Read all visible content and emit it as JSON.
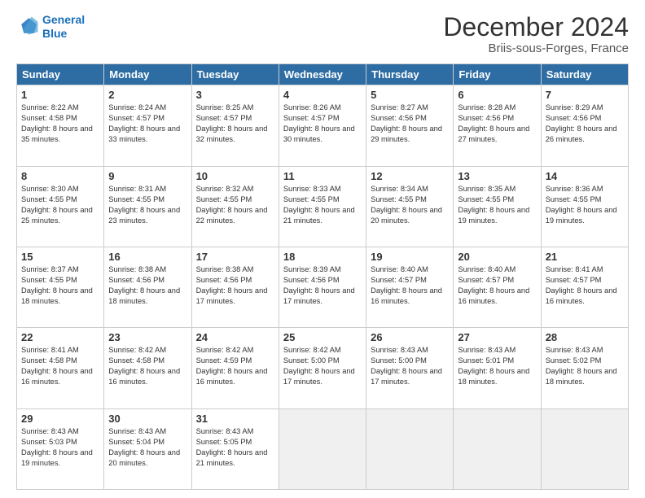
{
  "header": {
    "logo_line1": "General",
    "logo_line2": "Blue",
    "title": "December 2024",
    "subtitle": "Briis-sous-Forges, France"
  },
  "days_header": [
    "Sunday",
    "Monday",
    "Tuesday",
    "Wednesday",
    "Thursday",
    "Friday",
    "Saturday"
  ],
  "weeks": [
    [
      {
        "day": "1",
        "sunrise": "8:22 AM",
        "sunset": "4:58 PM",
        "daylight": "8 hours and 35 minutes."
      },
      {
        "day": "2",
        "sunrise": "8:24 AM",
        "sunset": "4:57 PM",
        "daylight": "8 hours and 33 minutes."
      },
      {
        "day": "3",
        "sunrise": "8:25 AM",
        "sunset": "4:57 PM",
        "daylight": "8 hours and 32 minutes."
      },
      {
        "day": "4",
        "sunrise": "8:26 AM",
        "sunset": "4:57 PM",
        "daylight": "8 hours and 30 minutes."
      },
      {
        "day": "5",
        "sunrise": "8:27 AM",
        "sunset": "4:56 PM",
        "daylight": "8 hours and 29 minutes."
      },
      {
        "day": "6",
        "sunrise": "8:28 AM",
        "sunset": "4:56 PM",
        "daylight": "8 hours and 27 minutes."
      },
      {
        "day": "7",
        "sunrise": "8:29 AM",
        "sunset": "4:56 PM",
        "daylight": "8 hours and 26 minutes."
      }
    ],
    [
      {
        "day": "8",
        "sunrise": "8:30 AM",
        "sunset": "4:55 PM",
        "daylight": "8 hours and 25 minutes."
      },
      {
        "day": "9",
        "sunrise": "8:31 AM",
        "sunset": "4:55 PM",
        "daylight": "8 hours and 23 minutes."
      },
      {
        "day": "10",
        "sunrise": "8:32 AM",
        "sunset": "4:55 PM",
        "daylight": "8 hours and 22 minutes."
      },
      {
        "day": "11",
        "sunrise": "8:33 AM",
        "sunset": "4:55 PM",
        "daylight": "8 hours and 21 minutes."
      },
      {
        "day": "12",
        "sunrise": "8:34 AM",
        "sunset": "4:55 PM",
        "daylight": "8 hours and 20 minutes."
      },
      {
        "day": "13",
        "sunrise": "8:35 AM",
        "sunset": "4:55 PM",
        "daylight": "8 hours and 19 minutes."
      },
      {
        "day": "14",
        "sunrise": "8:36 AM",
        "sunset": "4:55 PM",
        "daylight": "8 hours and 19 minutes."
      }
    ],
    [
      {
        "day": "15",
        "sunrise": "8:37 AM",
        "sunset": "4:55 PM",
        "daylight": "8 hours and 18 minutes."
      },
      {
        "day": "16",
        "sunrise": "8:38 AM",
        "sunset": "4:56 PM",
        "daylight": "8 hours and 18 minutes."
      },
      {
        "day": "17",
        "sunrise": "8:38 AM",
        "sunset": "4:56 PM",
        "daylight": "8 hours and 17 minutes."
      },
      {
        "day": "18",
        "sunrise": "8:39 AM",
        "sunset": "4:56 PM",
        "daylight": "8 hours and 17 minutes."
      },
      {
        "day": "19",
        "sunrise": "8:40 AM",
        "sunset": "4:57 PM",
        "daylight": "8 hours and 16 minutes."
      },
      {
        "day": "20",
        "sunrise": "8:40 AM",
        "sunset": "4:57 PM",
        "daylight": "8 hours and 16 minutes."
      },
      {
        "day": "21",
        "sunrise": "8:41 AM",
        "sunset": "4:57 PM",
        "daylight": "8 hours and 16 minutes."
      }
    ],
    [
      {
        "day": "22",
        "sunrise": "8:41 AM",
        "sunset": "4:58 PM",
        "daylight": "8 hours and 16 minutes."
      },
      {
        "day": "23",
        "sunrise": "8:42 AM",
        "sunset": "4:58 PM",
        "daylight": "8 hours and 16 minutes."
      },
      {
        "day": "24",
        "sunrise": "8:42 AM",
        "sunset": "4:59 PM",
        "daylight": "8 hours and 16 minutes."
      },
      {
        "day": "25",
        "sunrise": "8:42 AM",
        "sunset": "5:00 PM",
        "daylight": "8 hours and 17 minutes."
      },
      {
        "day": "26",
        "sunrise": "8:43 AM",
        "sunset": "5:00 PM",
        "daylight": "8 hours and 17 minutes."
      },
      {
        "day": "27",
        "sunrise": "8:43 AM",
        "sunset": "5:01 PM",
        "daylight": "8 hours and 18 minutes."
      },
      {
        "day": "28",
        "sunrise": "8:43 AM",
        "sunset": "5:02 PM",
        "daylight": "8 hours and 18 minutes."
      }
    ],
    [
      {
        "day": "29",
        "sunrise": "8:43 AM",
        "sunset": "5:03 PM",
        "daylight": "8 hours and 19 minutes."
      },
      {
        "day": "30",
        "sunrise": "8:43 AM",
        "sunset": "5:04 PM",
        "daylight": "8 hours and 20 minutes."
      },
      {
        "day": "31",
        "sunrise": "8:43 AM",
        "sunset": "5:05 PM",
        "daylight": "8 hours and 21 minutes."
      },
      null,
      null,
      null,
      null
    ]
  ]
}
